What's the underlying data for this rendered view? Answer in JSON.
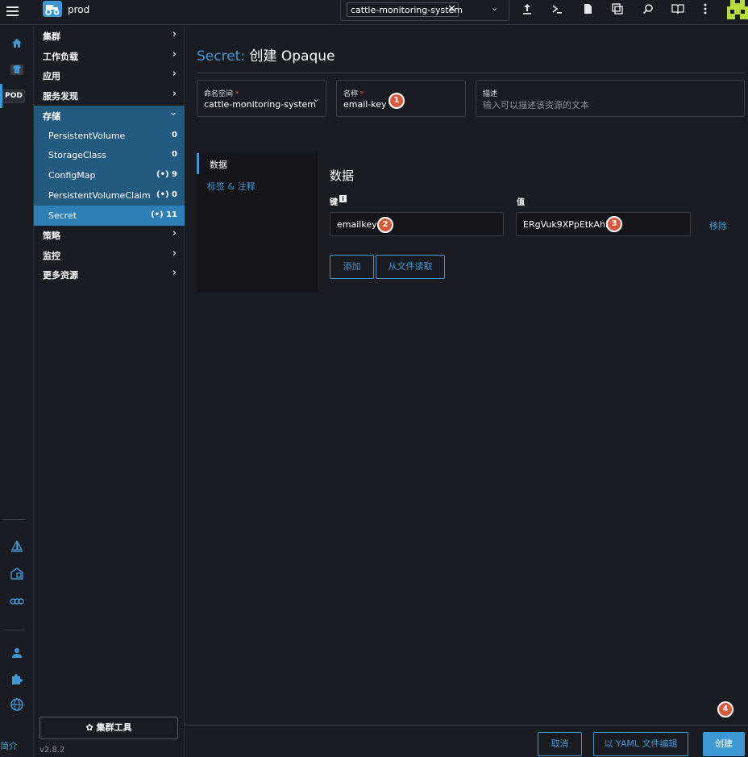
{
  "topbar": {
    "cluster_name": "prod",
    "namespace_chip": "cattle-monitoring-system",
    "remove_chip_glyph": "✕",
    "dropdown_glyph": "⌄",
    "icons": [
      "import-yaml-icon",
      "kubectl-shell-icon",
      "kubeconfig-download-icon",
      "copy-kubeconfig-icon",
      "search-icon",
      "docs-icon",
      "more-icon"
    ]
  },
  "rail": {
    "pod_badge": "POD",
    "about_link": "简介"
  },
  "nav": {
    "groups": [
      {
        "label": "集群"
      },
      {
        "label": "工作负载"
      },
      {
        "label": "应用"
      },
      {
        "label": "服务发现"
      },
      {
        "label": "存储"
      },
      {
        "label": "策略"
      },
      {
        "label": "监控"
      },
      {
        "label": "更多资源"
      }
    ],
    "storage_items": [
      {
        "label": "PersistentVolume",
        "count": "0"
      },
      {
        "label": "StorageClass",
        "count": "0"
      },
      {
        "label": "ConfigMap",
        "count": "(•) 9"
      },
      {
        "label": "PersistentVolumeClaim",
        "count": "(•) 0"
      },
      {
        "label": "Secret",
        "count": "(•) 11"
      }
    ],
    "cluster_tools": "✿ 集群工具",
    "version": "v2.8.2"
  },
  "page": {
    "title_prefix": "Secret:",
    "title_main": "创建 Opaque",
    "namespace_field": {
      "label": "命名空间",
      "required": "*",
      "value": "cattle-monitoring-system"
    },
    "name_field": {
      "label": "名称",
      "required": "*",
      "value": "email-key"
    },
    "description_field": {
      "label": "描述",
      "placeholder": "输入可以描述该资源的文本"
    },
    "tabs": [
      {
        "label": "数据"
      },
      {
        "label": "标签 & 注释"
      }
    ],
    "data_section": {
      "title": "数据",
      "key_label": "键",
      "value_label": "值",
      "key_value": "emailkey",
      "value_value": "ERgVuk9XPpEtkAhK",
      "remove": "移除",
      "add_button": "添加",
      "read_file_button": "从文件读取"
    }
  },
  "markers": [
    "1",
    "2",
    "3",
    "4"
  ],
  "footer": {
    "cancel": "取消",
    "edit_yaml": "以 YAML 文件编辑",
    "create": "创建"
  },
  "colors": {
    "accent": "#3d98d3",
    "nav_open": "#235a80",
    "nav_active": "#2e7fb8",
    "marker": "#d9583b",
    "background": "#1b1c21"
  }
}
